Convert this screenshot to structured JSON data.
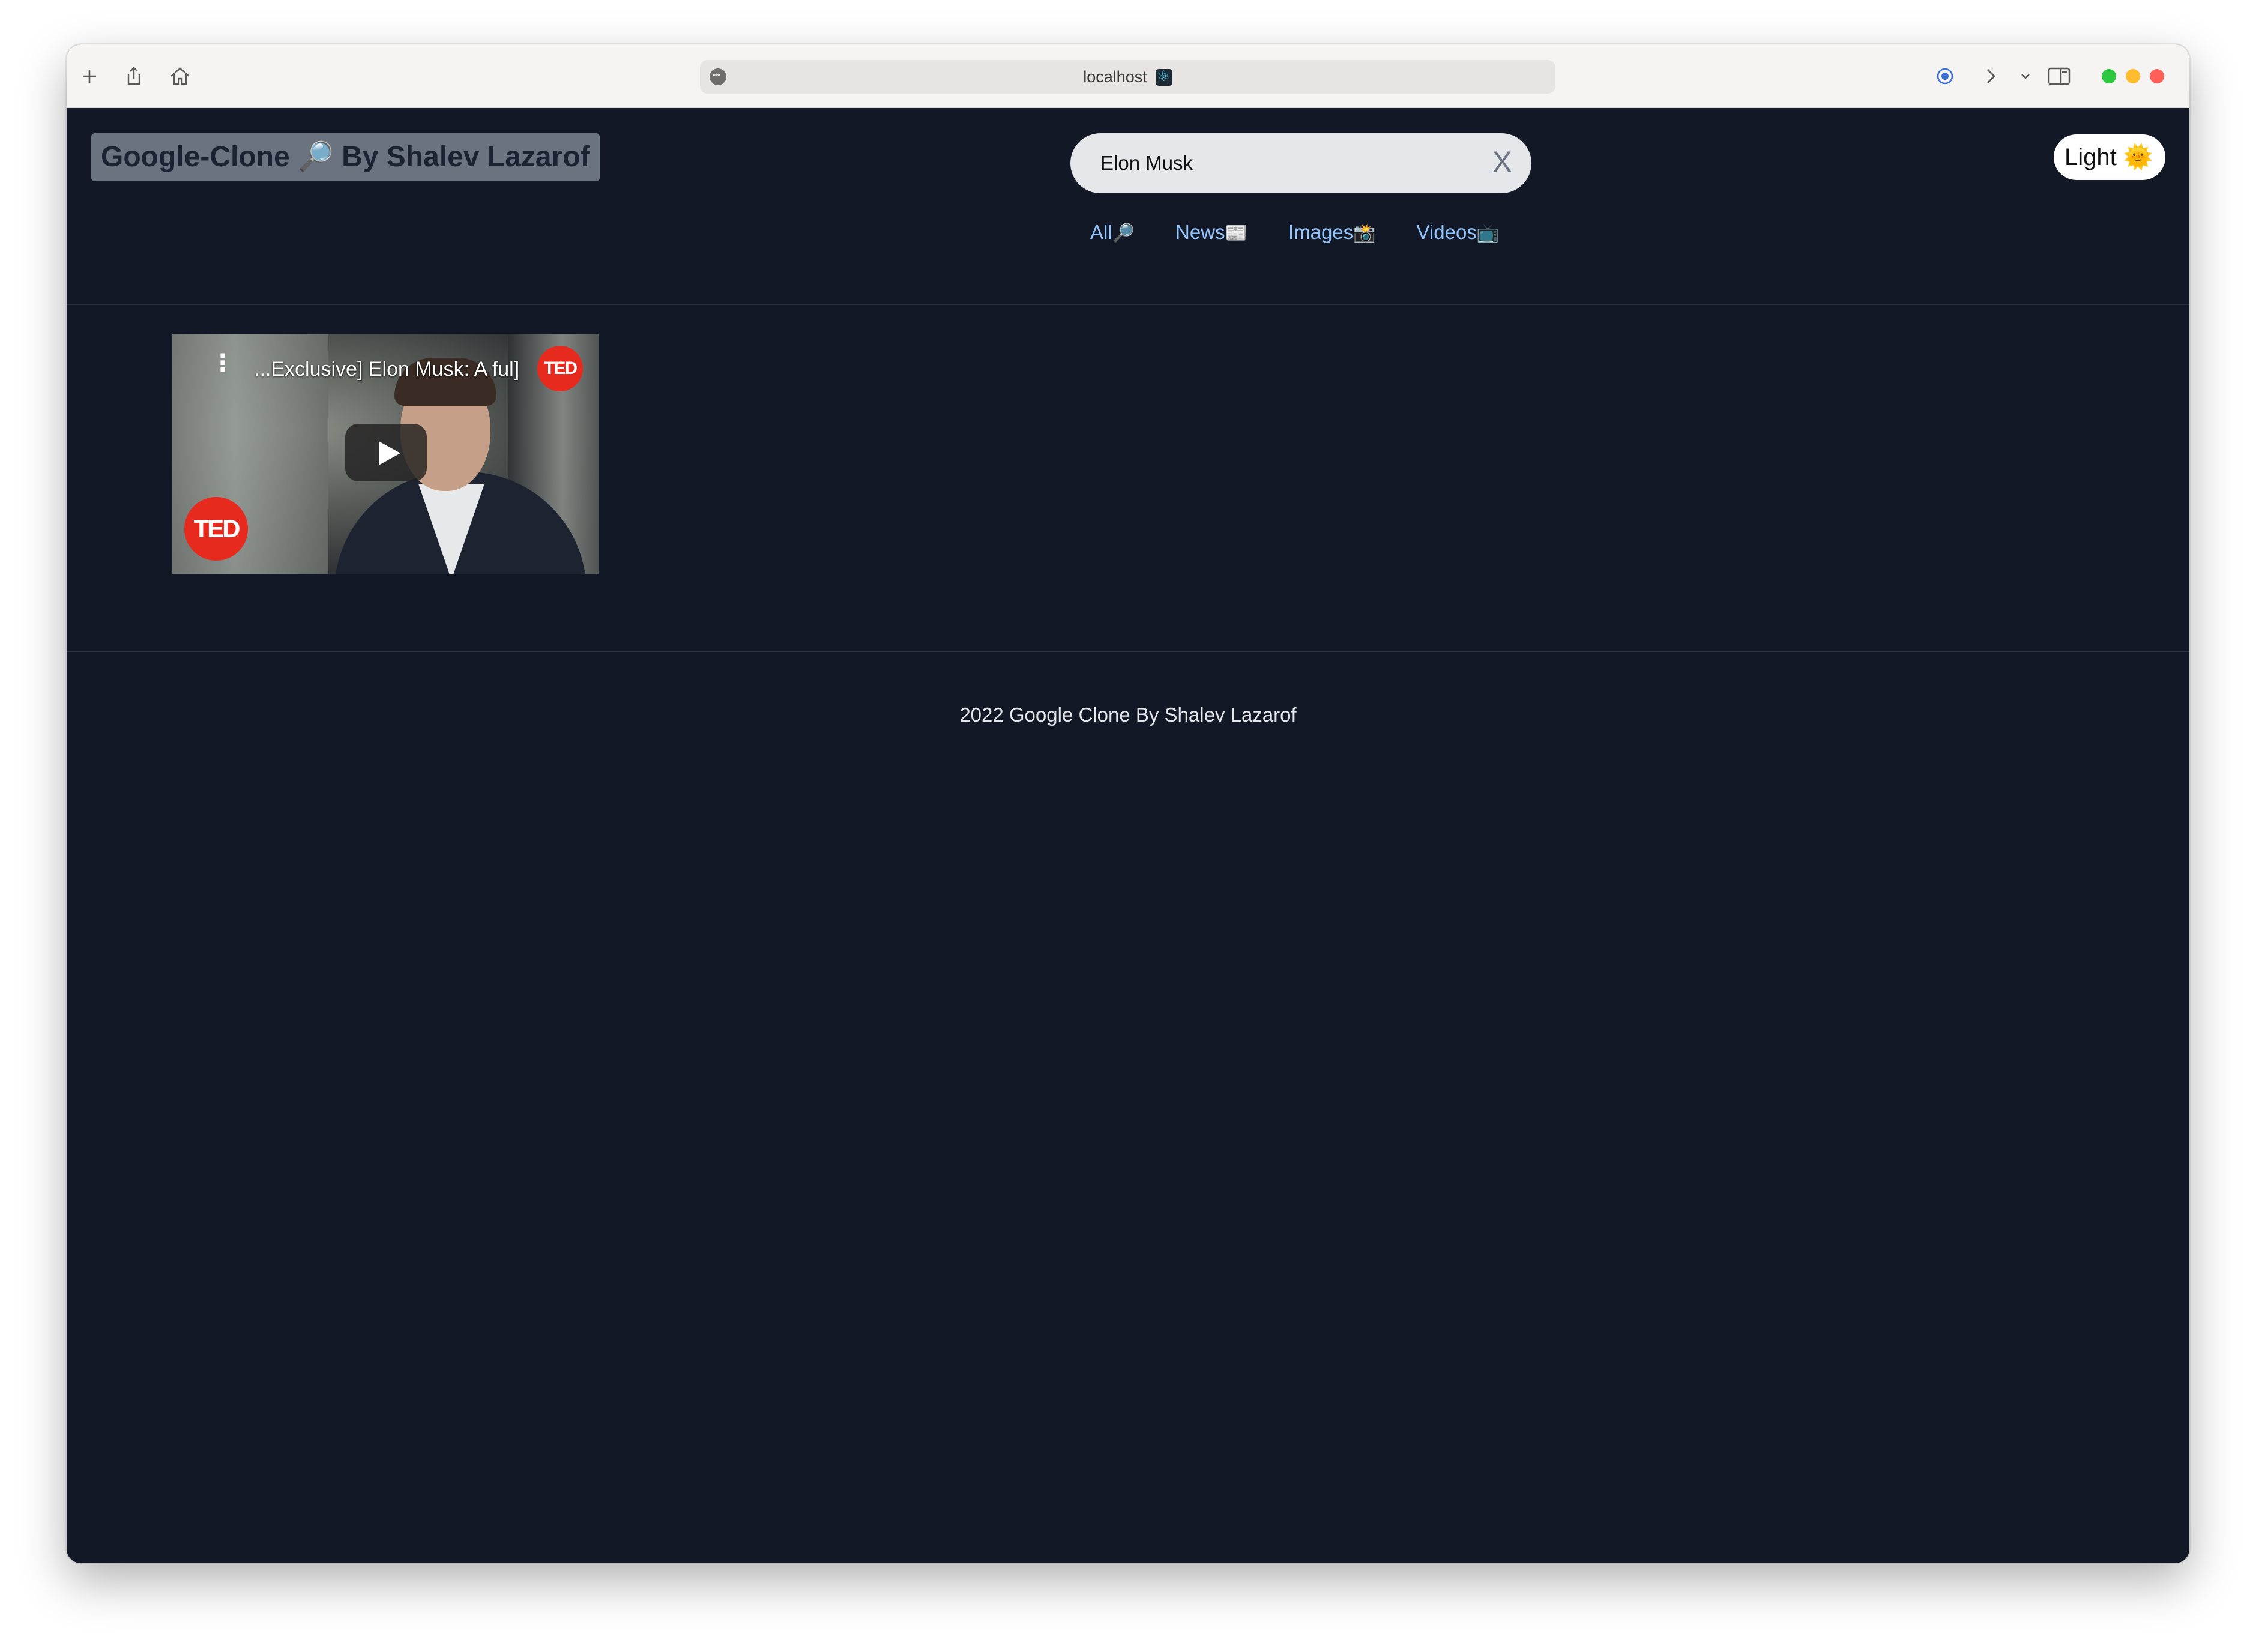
{
  "browser": {
    "address": "localhost",
    "traffic_colors": {
      "green": "#2bc840",
      "yellow": "#febc2e",
      "red": "#ff5f57"
    }
  },
  "header": {
    "brand": "Google-Clone 🔎 By Shalev Lazarof",
    "search_value": "Elon Musk",
    "clear_label": "X",
    "theme_toggle": "Light 🌞"
  },
  "tabs": [
    {
      "label": "All",
      "emoji": "🔎"
    },
    {
      "label": "News",
      "emoji": "📰"
    },
    {
      "label": "Images",
      "emoji": "📸"
    },
    {
      "label": "Videos",
      "emoji": "📺"
    }
  ],
  "results": {
    "videos": [
      {
        "title": "...Exclusive] Elon Musk: A ful]",
        "channel_badge": "TED"
      }
    ]
  },
  "footer": {
    "text": "2022 Google Clone By Shalev Lazarof"
  },
  "colors": {
    "page_background": "#131826",
    "tab_link": "#93c5fd",
    "brand_background": "#6b7280"
  }
}
